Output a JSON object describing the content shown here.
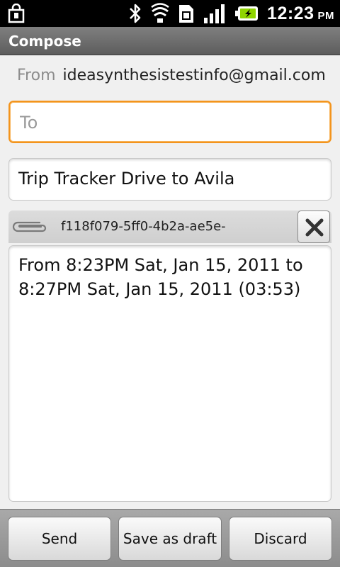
{
  "status_bar": {
    "icons": [
      "shopping-bag-icon",
      "bluetooth-icon",
      "wifi-icon",
      "sim-icon",
      "signal-icon",
      "battery-charging-icon"
    ],
    "time": "12:23",
    "ampm": "PM"
  },
  "title": "Compose",
  "from": {
    "label": "From",
    "value": "ideasynthesistestinfo@gmail.com"
  },
  "to": {
    "placeholder": "To",
    "value": ""
  },
  "subject": "Trip Tracker Drive to Avila",
  "attachment": {
    "icon": "paperclip-icon",
    "name": "f118f079-5ff0-4b2a-ae5e-"
  },
  "body": "From 8:23PM Sat, Jan 15, 2011 to 8:27PM Sat, Jan 15, 2011 (03:53)",
  "buttons": {
    "send": "Send",
    "save_draft": "Save as draft",
    "discard": "Discard"
  },
  "colors": {
    "focus_accent": "#f3941c",
    "battery": "#8fd400"
  }
}
